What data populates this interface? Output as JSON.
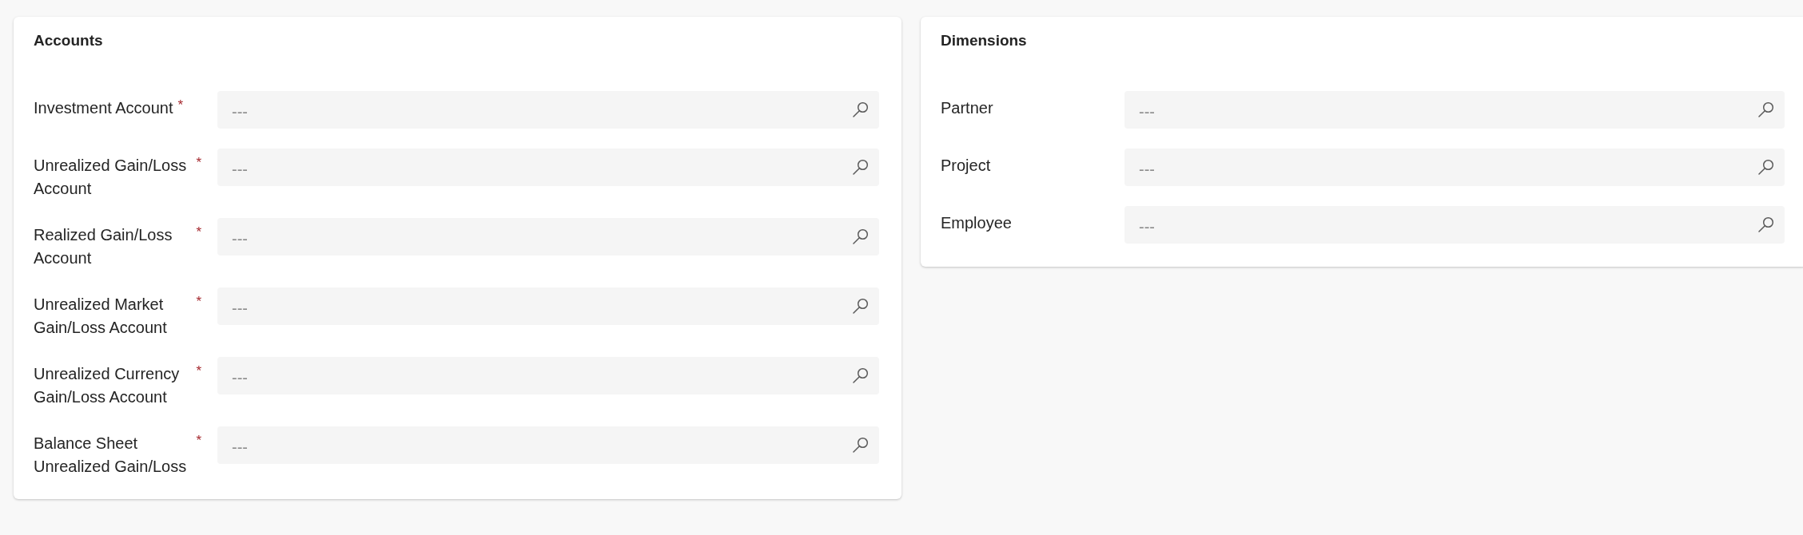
{
  "sections": [
    {
      "title": "Accounts",
      "fields": [
        {
          "label": "Investment Account",
          "required_mark": "*",
          "placeholder": "---"
        },
        {
          "label": "Unrealized Gain/Loss Account",
          "required_mark": "*",
          "placeholder": "---"
        },
        {
          "label": "Realized Gain/Loss Account",
          "required_mark": "*",
          "placeholder": "---"
        },
        {
          "label": "Unrealized Market Gain/Loss Account",
          "required_mark": "*",
          "placeholder": "---"
        },
        {
          "label": "Unrealized Currency Gain/Loss Account",
          "required_mark": "*",
          "placeholder": "---"
        },
        {
          "label": "Balance Sheet Unrealized Gain/Loss",
          "required_mark": "*",
          "placeholder": "---"
        }
      ]
    },
    {
      "title": "Dimensions",
      "fields": [
        {
          "label": "Partner",
          "placeholder": "---"
        },
        {
          "label": "Project",
          "placeholder": "---"
        },
        {
          "label": "Employee",
          "placeholder": "---"
        }
      ]
    }
  ]
}
